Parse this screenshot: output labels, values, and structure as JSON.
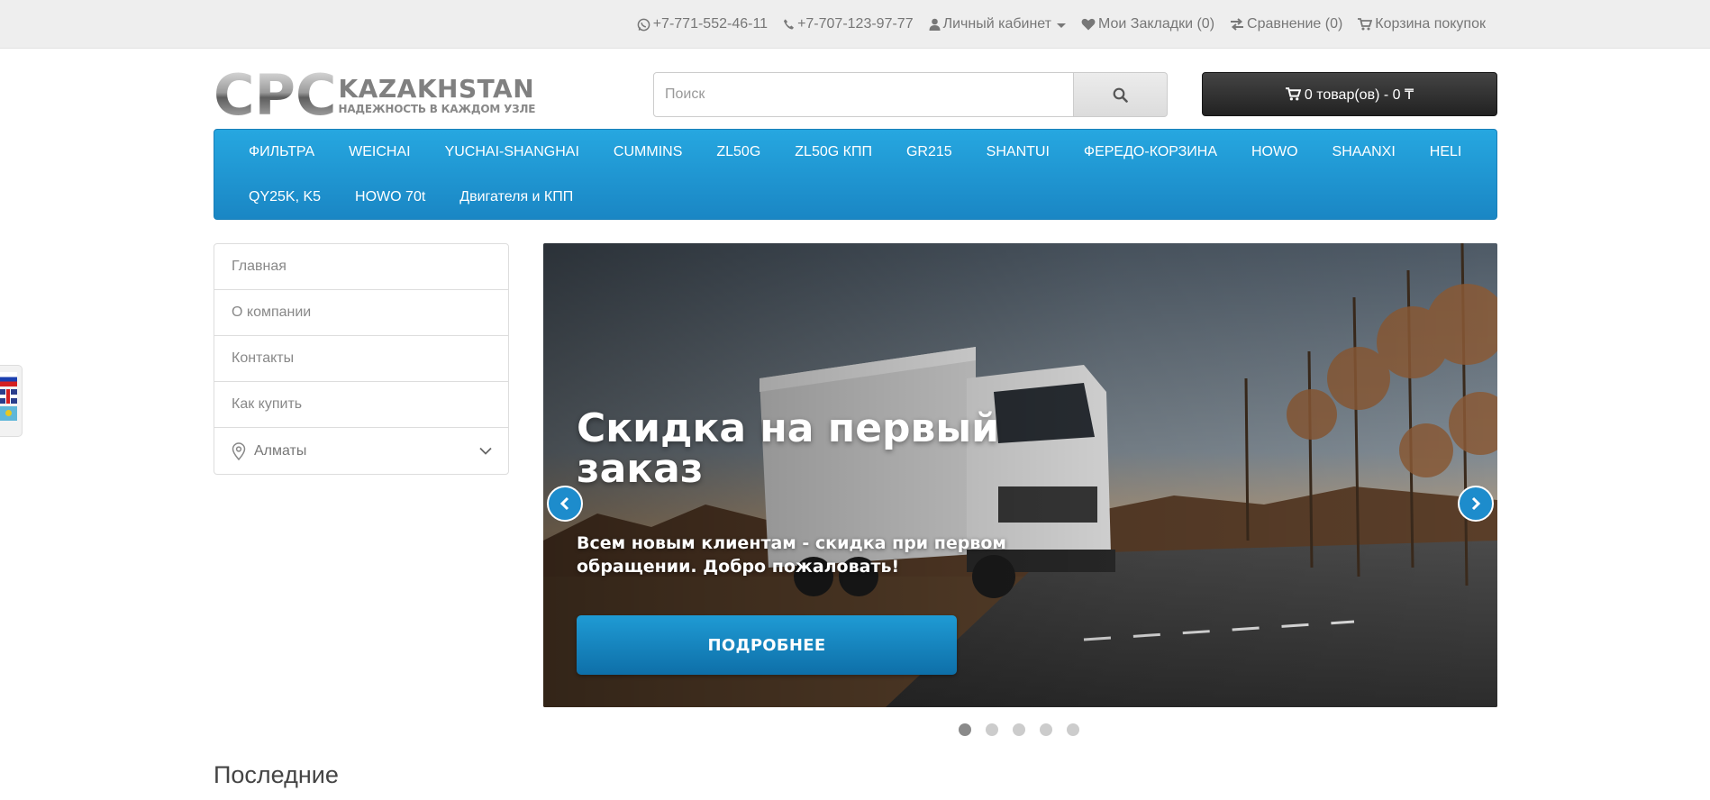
{
  "topbar": {
    "phone1": "+7-771-552-46-11",
    "phone2": "+7-707-123-97-77",
    "account": "Личный кабинет",
    "wishlist": "Мои Закладки (0)",
    "compare": "Сравнение (0)",
    "cart": "Корзина покупок"
  },
  "logo": {
    "letters": [
      "C",
      "P",
      "C"
    ],
    "brand": "KAZAKHSTAN",
    "tagline": "НАДЕЖНОСТЬ В КАЖДОМ УЗЛЕ"
  },
  "search": {
    "placeholder": "Поиск"
  },
  "cart_button": {
    "label": "0 товар(ов) - 0 ₸"
  },
  "menu": {
    "row1": [
      "ФИЛЬТРА",
      "WEICHAI",
      "YUCHAI-SHANGHAI",
      "CUMMINS",
      "ZL50G",
      "ZL50G КПП",
      "GR215",
      "SHANTUI",
      "ФЕРЕДО-КОРЗИНА",
      "HOWO",
      "SHAANXI",
      "HELI"
    ],
    "row2": [
      "QY25K, K5",
      "HOWO 70t",
      "Двигателя и КПП"
    ]
  },
  "sidebar": {
    "items": [
      "Главная",
      "О компании",
      "Контакты",
      "Как купить"
    ],
    "city": "Алматы"
  },
  "slider": {
    "title": "Скидка на первый заказ",
    "text": "Всем новым клиентам - скидка при первом обращении. Добро пожаловать!",
    "button": "ПОДРОБНЕЕ",
    "slide_count": 5,
    "active_slide": 1
  },
  "section": {
    "latest": "Последние"
  },
  "colors": {
    "menu": "#1f95d2",
    "cart": "#2f2f2f",
    "accent": "#1a86c4"
  }
}
